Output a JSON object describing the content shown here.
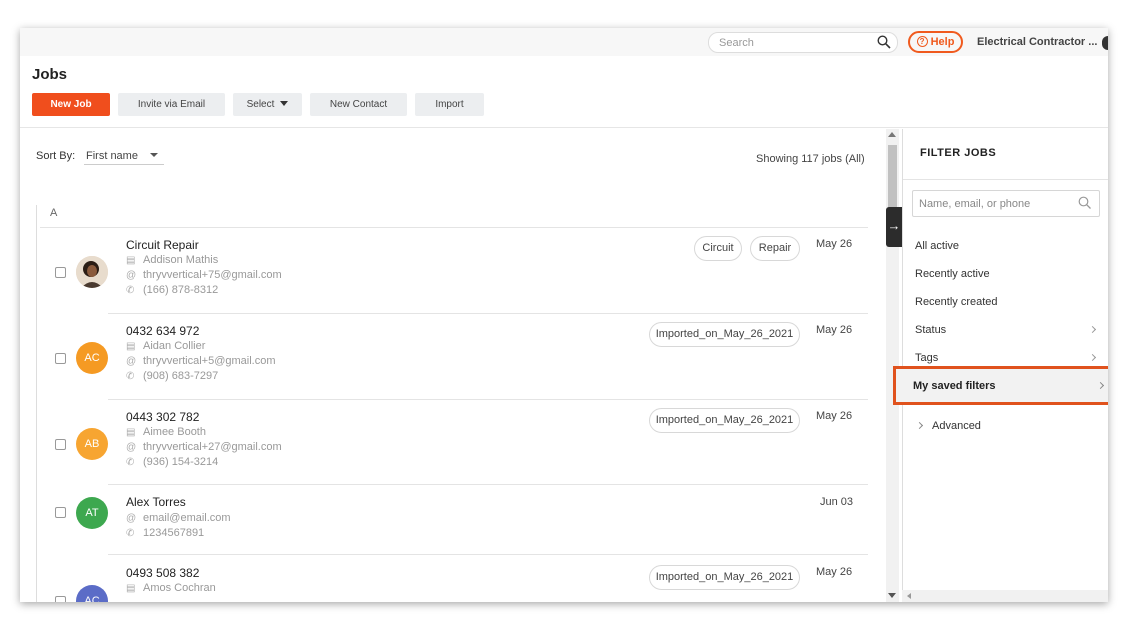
{
  "topbar": {
    "search_placeholder": "Search",
    "help_label": "Help",
    "help_glyph": "?",
    "account_name": "Electrical Contractor ..."
  },
  "header": {
    "title": "Jobs",
    "buttons": {
      "new_job": "New Job",
      "invite": "Invite via Email",
      "select": "Select",
      "new_contact": "New Contact",
      "import": "Import"
    }
  },
  "list": {
    "sort_label": "Sort By:",
    "sort_value": "First name",
    "showing": "Showing 117 jobs (All)",
    "group_letter": "A",
    "rows": [
      {
        "title": "Circuit Repair",
        "contact": "Addison Mathis",
        "email": "thryvvertical+75@gmail.com",
        "phone": "(166) 878-8312",
        "tags": [
          "Circuit",
          "Repair"
        ],
        "date": "May 26",
        "avatar": "photo"
      },
      {
        "title": "0432 634 972",
        "contact": "Aidan Collier",
        "email": "thryvvertical+5@gmail.com",
        "phone": "(908) 683-7297",
        "tags": [
          "Imported_on_May_26_2021"
        ],
        "date": "May 26",
        "avatar": "AC",
        "avatar_color": "#f59a23"
      },
      {
        "title": "0443 302 782",
        "contact": "Aimee Booth",
        "email": "thryvvertical+27@gmail.com",
        "phone": "(936) 154-3214",
        "tags": [
          "Imported_on_May_26_2021"
        ],
        "date": "May 26",
        "avatar": "AB",
        "avatar_color": "#f7a531"
      },
      {
        "title": "Alex Torres",
        "email": "email@email.com",
        "phone": "1234567891",
        "date": "Jun 03",
        "avatar": "AT",
        "avatar_color": "#3da84f"
      },
      {
        "title": "0493 508 382",
        "contact": "Amos Cochran",
        "tags": [
          "Imported_on_May_26_2021"
        ],
        "date": "May 26",
        "avatar": "AC",
        "avatar_color": "#5b6cc7"
      }
    ]
  },
  "filter_panel": {
    "title": "FILTER JOBS",
    "search_placeholder": "Name, email, or phone",
    "items": [
      "All active",
      "Recently active",
      "Recently created",
      "Status",
      "Tags"
    ],
    "saved_filters": "My saved filters",
    "advanced": "Advanced"
  },
  "colors": {
    "primary": "#f04e1d",
    "highlight_border": "#e0521d"
  }
}
